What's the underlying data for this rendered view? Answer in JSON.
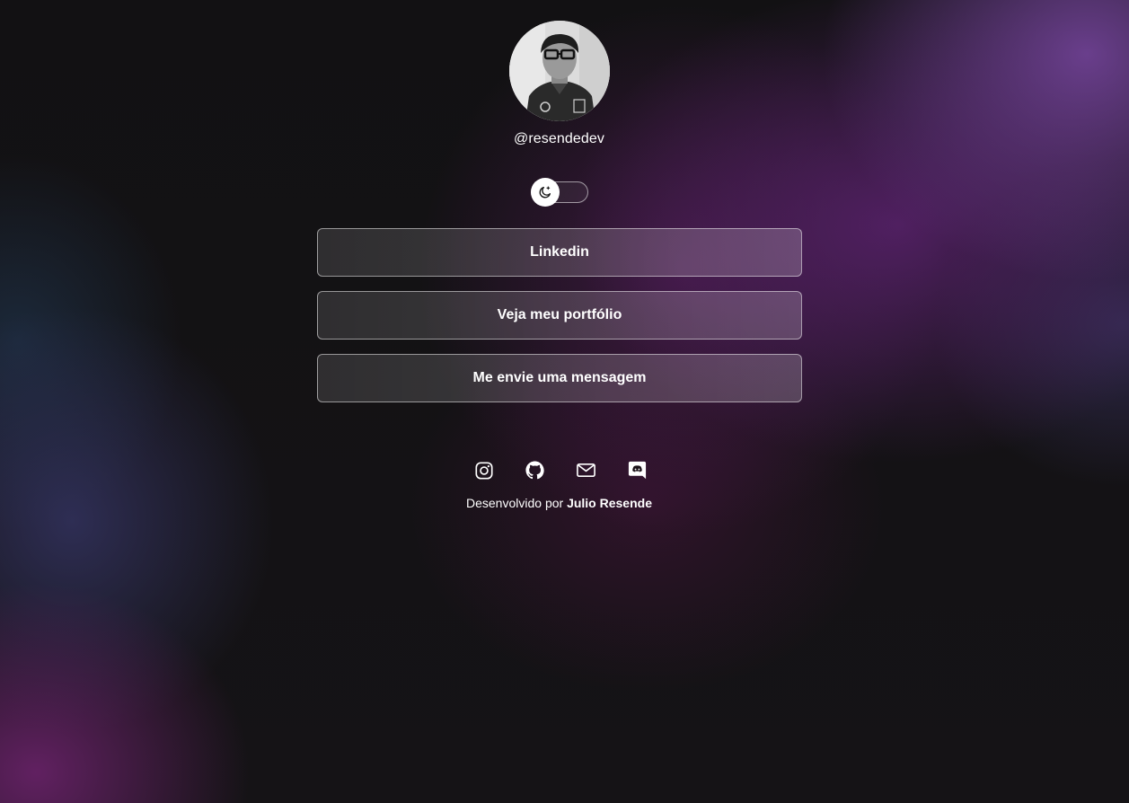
{
  "profile": {
    "handle": "@resendedev"
  },
  "theme_toggle": {
    "icon": "moon-icon",
    "state": "dark"
  },
  "links": [
    {
      "label": "Linkedin"
    },
    {
      "label": "Veja meu portfólio"
    },
    {
      "label": "Me envie uma mensagem"
    }
  ],
  "socials": [
    {
      "icon": "instagram-icon"
    },
    {
      "icon": "github-icon"
    },
    {
      "icon": "mail-icon"
    },
    {
      "icon": "discord-icon"
    }
  ],
  "footer": {
    "prefix": "Desenvolvido por",
    "author": "Julio Resende"
  },
  "colors": {
    "text": "#ffffff",
    "background": "#131214",
    "accent_purple": "#6a2c82"
  }
}
